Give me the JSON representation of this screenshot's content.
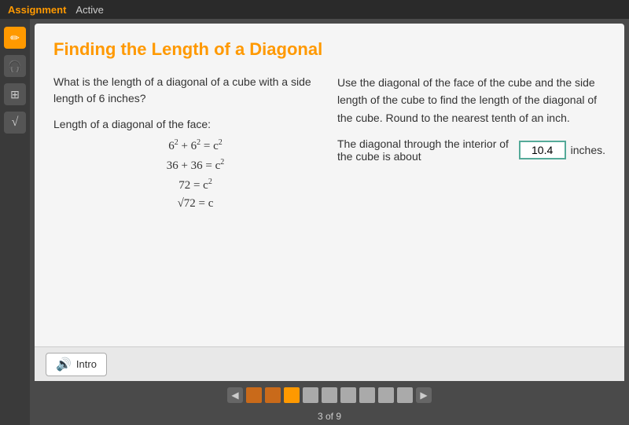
{
  "topbar": {
    "tab_assignment": "Assignment",
    "tab_active": "Active"
  },
  "sidebar": {
    "icons": [
      {
        "name": "pencil-icon",
        "symbol": "✏",
        "active": true
      },
      {
        "name": "headphone-icon",
        "symbol": "🎧",
        "active": false
      },
      {
        "name": "calculator-icon",
        "symbol": "🖩",
        "active": false
      },
      {
        "name": "formula-icon",
        "symbol": "√",
        "active": false
      }
    ]
  },
  "page": {
    "title": "Finding the Length of a Diagonal",
    "left_col": {
      "question": "What is the length of a diagonal of a cube with a side length of 6 inches?",
      "face_label": "Length of a diagonal of the face:",
      "math_steps": [
        "6² + 6² = c²",
        "36 + 36 = c²",
        "72 = c²",
        "√72 = c"
      ]
    },
    "right_col": {
      "instruction": "Use the diagonal of the face of the cube and the side length of the cube to find the length of the diagonal of the cube. Round to the nearest tenth of an inch.",
      "answer_prefix": "The diagonal through the interior of the cube is about",
      "answer_value": "10.4",
      "answer_suffix": "inches."
    }
  },
  "bottom": {
    "intro_label": "Intro"
  },
  "navigation": {
    "prev_label": "◀",
    "next_label": "▶",
    "page_indicator": "3 of 9",
    "pages": [
      {
        "type": "filled"
      },
      {
        "type": "filled"
      },
      {
        "type": "active"
      },
      {
        "type": "empty"
      },
      {
        "type": "empty"
      },
      {
        "type": "empty"
      },
      {
        "type": "empty"
      },
      {
        "type": "empty"
      },
      {
        "type": "empty"
      }
    ]
  }
}
